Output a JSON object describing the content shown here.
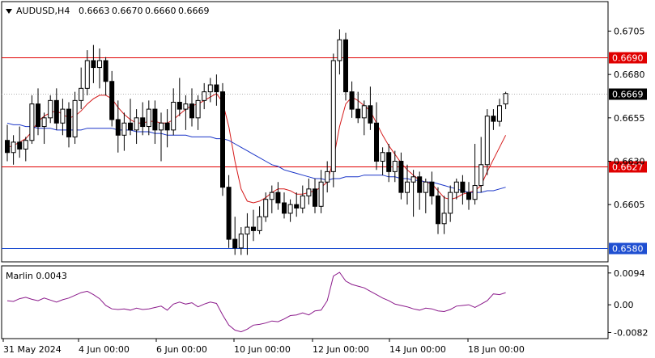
{
  "chart_data": [
    {
      "type": "candlestick",
      "symbol": "AUDUSD,H4",
      "ohlc_header": {
        "open": "0.6663",
        "high": "0.6670",
        "low": "0.6660",
        "close": "0.6669"
      },
      "x_tick_labels": [
        "31 May 2024",
        "4 Jun 00:00",
        "6 Jun 00:00",
        "10 Jun 00:00",
        "12 Jun 00:00",
        "14 Jun 00:00",
        "18 Jun 00:00"
      ],
      "y_tick_labels": [
        "0.6705",
        "0.6680",
        "0.6655",
        "0.6630",
        "0.6605"
      ],
      "ylim": [
        0.6572,
        0.6722
      ],
      "levels": [
        {
          "value": 0.669,
          "label": "0.6690",
          "color": "#e00000"
        },
        {
          "value": 0.6627,
          "label": "0.6627",
          "color": "#e00000"
        },
        {
          "value": 0.658,
          "label": "0.6580",
          "color": "#1f4fd1"
        }
      ],
      "current_price": {
        "value": 0.6669,
        "label": "0.6669"
      },
      "candles": [
        [
          0.6642,
          0.6651,
          0.663,
          0.6635
        ],
        [
          0.6635,
          0.6645,
          0.6628,
          0.6641
        ],
        [
          0.6641,
          0.665,
          0.6632,
          0.6637
        ],
        [
          0.6637,
          0.6644,
          0.663,
          0.6642
        ],
        [
          0.6642,
          0.6668,
          0.664,
          0.6663
        ],
        [
          0.6663,
          0.6672,
          0.6645,
          0.665
        ],
        [
          0.665,
          0.6658,
          0.664,
          0.6655
        ],
        [
          0.6655,
          0.6668,
          0.6652,
          0.6665
        ],
        [
          0.6665,
          0.6672,
          0.6648,
          0.6652
        ],
        [
          0.6652,
          0.6666,
          0.6645,
          0.666
        ],
        [
          0.666,
          0.6664,
          0.6638,
          0.6644
        ],
        [
          0.6644,
          0.667,
          0.664,
          0.6665
        ],
        [
          0.6665,
          0.6684,
          0.666,
          0.6672
        ],
        [
          0.6672,
          0.6694,
          0.6668,
          0.6688
        ],
        [
          0.6688,
          0.6697,
          0.6675,
          0.6684
        ],
        [
          0.6684,
          0.6695,
          0.6672,
          0.6688
        ],
        [
          0.6688,
          0.669,
          0.6668,
          0.6676
        ],
        [
          0.6676,
          0.6682,
          0.665,
          0.6654
        ],
        [
          0.6654,
          0.6665,
          0.6635,
          0.6645
        ],
        [
          0.6645,
          0.6658,
          0.6636,
          0.6652
        ],
        [
          0.6652,
          0.6666,
          0.6645,
          0.6648
        ],
        [
          0.6648,
          0.666,
          0.664,
          0.6655
        ],
        [
          0.6655,
          0.6664,
          0.6645,
          0.665
        ],
        [
          0.665,
          0.6665,
          0.6645,
          0.666
        ],
        [
          0.666,
          0.6665,
          0.664,
          0.6648
        ],
        [
          0.6648,
          0.6658,
          0.663,
          0.6652
        ],
        [
          0.6652,
          0.666,
          0.6638,
          0.6648
        ],
        [
          0.6648,
          0.6672,
          0.6645,
          0.6664
        ],
        [
          0.6664,
          0.6678,
          0.6656,
          0.666
        ],
        [
          0.666,
          0.6668,
          0.6648,
          0.6663
        ],
        [
          0.6663,
          0.6672,
          0.665,
          0.6655
        ],
        [
          0.6655,
          0.6668,
          0.6648,
          0.6665
        ],
        [
          0.6665,
          0.6675,
          0.666,
          0.667
        ],
        [
          0.667,
          0.6678,
          0.6664,
          0.6674
        ],
        [
          0.6674,
          0.668,
          0.6662,
          0.667
        ],
        [
          0.667,
          0.6675,
          0.661,
          0.6615
        ],
        [
          0.6615,
          0.6622,
          0.658,
          0.6585
        ],
        [
          0.6585,
          0.6598,
          0.6576,
          0.658
        ],
        [
          0.658,
          0.6592,
          0.6576,
          0.6588
        ],
        [
          0.6588,
          0.66,
          0.6576,
          0.6592
        ],
        [
          0.6592,
          0.6602,
          0.6584,
          0.659
        ],
        [
          0.659,
          0.6604,
          0.6588,
          0.6598
        ],
        [
          0.6598,
          0.6612,
          0.6595,
          0.6608
        ],
        [
          0.6608,
          0.6616,
          0.66,
          0.6612
        ],
        [
          0.6612,
          0.6618,
          0.6602,
          0.6606
        ],
        [
          0.6606,
          0.6612,
          0.6597,
          0.66
        ],
        [
          0.66,
          0.6608,
          0.6595,
          0.6605
        ],
        [
          0.6605,
          0.6612,
          0.6598,
          0.6603
        ],
        [
          0.6603,
          0.6616,
          0.66,
          0.661
        ],
        [
          0.661,
          0.662,
          0.6605,
          0.6614
        ],
        [
          0.6614,
          0.662,
          0.66,
          0.6604
        ],
        [
          0.6604,
          0.6625,
          0.66,
          0.6618
        ],
        [
          0.6618,
          0.663,
          0.6612,
          0.6624
        ],
        [
          0.6624,
          0.6692,
          0.6615,
          0.6688
        ],
        [
          0.6688,
          0.6706,
          0.668,
          0.67
        ],
        [
          0.67,
          0.6704,
          0.6665,
          0.667
        ],
        [
          0.667,
          0.6676,
          0.6655,
          0.666
        ],
        [
          0.666,
          0.667,
          0.6652,
          0.6655
        ],
        [
          0.6655,
          0.6665,
          0.6645,
          0.6662
        ],
        [
          0.6662,
          0.6673,
          0.6648,
          0.6652
        ],
        [
          0.6652,
          0.6664,
          0.6625,
          0.663
        ],
        [
          0.663,
          0.6638,
          0.6622,
          0.6635
        ],
        [
          0.6635,
          0.664,
          0.6618,
          0.6624
        ],
        [
          0.6624,
          0.6636,
          0.6618,
          0.663
        ],
        [
          0.663,
          0.6635,
          0.6608,
          0.6612
        ],
        [
          0.6612,
          0.6628,
          0.6605,
          0.6618
        ],
        [
          0.6618,
          0.6625,
          0.6598,
          0.6621
        ],
        [
          0.6621,
          0.6624,
          0.6602,
          0.6612
        ],
        [
          0.6612,
          0.662,
          0.66,
          0.6618
        ],
        [
          0.6618,
          0.6624,
          0.6605,
          0.661
        ],
        [
          0.661,
          0.6615,
          0.6588,
          0.6594
        ],
        [
          0.6594,
          0.661,
          0.6588,
          0.66
        ],
        [
          0.66,
          0.6616,
          0.6595,
          0.6612
        ],
        [
          0.6612,
          0.662,
          0.6608,
          0.6618
        ],
        [
          0.6618,
          0.6622,
          0.6605,
          0.6612
        ],
        [
          0.6612,
          0.6618,
          0.6602,
          0.6608
        ],
        [
          0.6608,
          0.664,
          0.6605,
          0.6616
        ],
        [
          0.6616,
          0.6644,
          0.6612,
          0.6628
        ],
        [
          0.6628,
          0.666,
          0.6622,
          0.6656
        ],
        [
          0.6656,
          0.666,
          0.6648,
          0.6653
        ],
        [
          0.6653,
          0.6666,
          0.665,
          0.6662
        ],
        [
          0.6663,
          0.667,
          0.666,
          0.6669
        ]
      ],
      "series": [
        {
          "kind": "ma_fast",
          "color": "#d51b1b",
          "values": [
            0.6638,
            0.6639,
            0.6641,
            0.6643,
            0.6647,
            0.6653,
            0.6656,
            0.6658,
            0.6659,
            0.6657,
            0.6655,
            0.6656,
            0.6659,
            0.6663,
            0.6666,
            0.6668,
            0.6668,
            0.6666,
            0.6661,
            0.6657,
            0.6654,
            0.6652,
            0.6652,
            0.6653,
            0.6653,
            0.6652,
            0.6652,
            0.6654,
            0.6657,
            0.666,
            0.6662,
            0.6663,
            0.6665,
            0.6667,
            0.6669,
            0.6664,
            0.665,
            0.663,
            0.6614,
            0.6607,
            0.6606,
            0.6607,
            0.6609,
            0.6612,
            0.6614,
            0.6614,
            0.6613,
            0.6611,
            0.6611,
            0.6612,
            0.6613,
            0.6615,
            0.6618,
            0.6631,
            0.665,
            0.6663,
            0.6667,
            0.6665,
            0.6662,
            0.6659,
            0.6652,
            0.6645,
            0.6639,
            0.6634,
            0.6629,
            0.6625,
            0.6622,
            0.6619,
            0.6618,
            0.6617,
            0.6613,
            0.6609,
            0.6608,
            0.6609,
            0.6611,
            0.6612,
            0.6613,
            0.6616,
            0.6624,
            0.6631,
            0.6638,
            0.6645
          ]
        },
        {
          "kind": "ma_slow",
          "color": "#1a35c8",
          "values": [
            0.6652,
            0.6651,
            0.6651,
            0.665,
            0.665,
            0.6649,
            0.6649,
            0.6649,
            0.6648,
            0.6648,
            0.6648,
            0.6648,
            0.6648,
            0.6649,
            0.6649,
            0.6649,
            0.6649,
            0.6649,
            0.6648,
            0.6648,
            0.6648,
            0.6647,
            0.6647,
            0.6647,
            0.6646,
            0.6646,
            0.6645,
            0.6645,
            0.6645,
            0.6645,
            0.6644,
            0.6644,
            0.6644,
            0.6644,
            0.6643,
            0.6643,
            0.6642,
            0.664,
            0.6638,
            0.6636,
            0.6634,
            0.6632,
            0.663,
            0.6628,
            0.6627,
            0.6625,
            0.6624,
            0.6623,
            0.6622,
            0.6621,
            0.662,
            0.662,
            0.6619,
            0.662,
            0.662,
            0.6621,
            0.6621,
            0.6621,
            0.6622,
            0.6622,
            0.6622,
            0.6622,
            0.6621,
            0.6621,
            0.662,
            0.662,
            0.6619,
            0.6619,
            0.6618,
            0.6618,
            0.6617,
            0.6616,
            0.6615,
            0.6614,
            0.6613,
            0.6612,
            0.6612,
            0.6612,
            0.6613,
            0.6613,
            0.6614,
            0.6615
          ]
        }
      ]
    },
    {
      "type": "line",
      "indicator_label": "Marlin 0.0043",
      "y_tick_labels": [
        "0.0094",
        "0.00",
        "-0.0082"
      ],
      "ylim": [
        -0.01,
        0.0115
      ],
      "series": [
        {
          "kind": "marlin",
          "color": "#8b1a8b",
          "values": [
            0.0012,
            0.001,
            0.0018,
            0.0022,
            0.0016,
            0.0012,
            0.002,
            0.0014,
            0.0008,
            0.0015,
            0.002,
            0.0028,
            0.0036,
            0.004,
            0.003,
            0.0018,
            -0.0002,
            -0.0012,
            -0.0014,
            -0.0012,
            -0.0016,
            -0.001,
            -0.0014,
            -0.0012,
            -0.0008,
            -0.0004,
            -0.0016,
            0.0002,
            0.0008,
            0.0002,
            0.0006,
            -0.0006,
            0.0002,
            0.0008,
            0.0004,
            -0.003,
            -0.006,
            -0.0075,
            -0.008,
            -0.0072,
            -0.006,
            -0.0058,
            -0.0054,
            -0.0048,
            -0.005,
            -0.0042,
            -0.0032,
            -0.003,
            -0.0024,
            -0.003,
            -0.0018,
            -0.0016,
            0.0012,
            0.0085,
            0.0096,
            0.007,
            0.006,
            0.0055,
            0.005,
            0.004,
            0.003,
            0.002,
            0.0012,
            0.0002,
            -0.0002,
            -0.0006,
            -0.0012,
            -0.0016,
            -0.001,
            -0.0012,
            -0.0018,
            -0.002,
            -0.0014,
            -0.0004,
            -0.0002,
            0.0,
            -0.0008,
            0.0002,
            0.0012,
            0.0032,
            0.003,
            0.0036
          ]
        }
      ]
    }
  ]
}
